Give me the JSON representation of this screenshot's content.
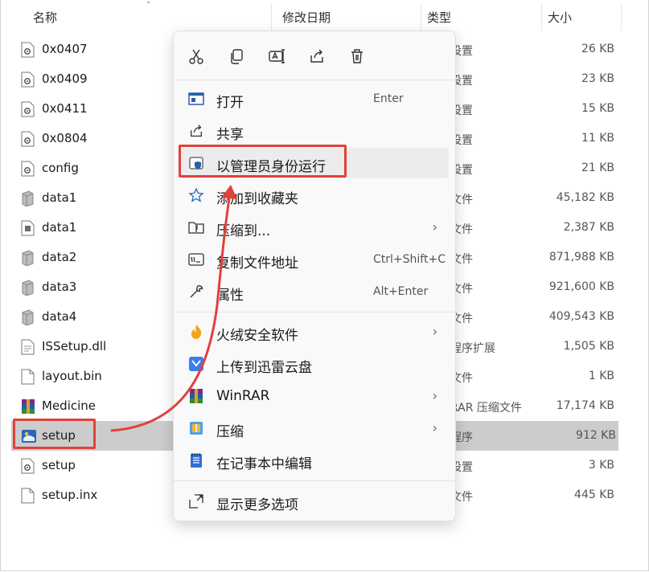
{
  "header": {
    "name": "名称",
    "date": "修改日期",
    "type": "类型",
    "size": "大小"
  },
  "files": [
    {
      "name": "0x0407",
      "icon": "settings-file-icon",
      "type": "设置",
      "size": "26 KB"
    },
    {
      "name": "0x0409",
      "icon": "settings-file-icon",
      "type": "设置",
      "size": "23 KB"
    },
    {
      "name": "0x0411",
      "icon": "settings-file-icon",
      "type": "设置",
      "size": "15 KB"
    },
    {
      "name": "0x0804",
      "icon": "settings-file-icon",
      "type": "设置",
      "size": "11 KB"
    },
    {
      "name": "config",
      "icon": "settings-file-icon",
      "type": "设置",
      "size": "21 KB"
    },
    {
      "name": "data1",
      "icon": "cabinet-file-icon",
      "type": "文件",
      "size": "45,182 KB"
    },
    {
      "name": "data1",
      "icon": "header-file-icon",
      "type": "文件",
      "size": "2,387 KB"
    },
    {
      "name": "data2",
      "icon": "cabinet-file-icon",
      "type": "文件",
      "size": "871,988 KB"
    },
    {
      "name": "data3",
      "icon": "cabinet-file-icon",
      "type": "文件",
      "size": "921,600 KB"
    },
    {
      "name": "data4",
      "icon": "cabinet-file-icon",
      "type": "文件",
      "size": "409,543 KB"
    },
    {
      "name": "ISSetup.dll",
      "icon": "dll-file-icon",
      "type": "程序扩展",
      "size": "1,505 KB"
    },
    {
      "name": "layout.bin",
      "icon": "blank-file-icon",
      "type": "文件",
      "size": "1 KB"
    },
    {
      "name": "Medicine",
      "icon": "winrar-archive-icon",
      "type": "RAR 压缩文件",
      "size": "17,174 KB"
    },
    {
      "name": "setup",
      "icon": "setup-app-icon",
      "type": "程序",
      "size": "912 KB",
      "selected": true
    },
    {
      "name": "setup",
      "icon": "settings-file-icon",
      "type": "设置",
      "size": "3 KB"
    },
    {
      "name": "setup.inx",
      "icon": "blank-file-icon",
      "type": "文件",
      "size": "445 KB"
    }
  ],
  "quick_actions": [
    "cut-icon",
    "copy-icon",
    "rename-icon",
    "share-icon",
    "delete-icon"
  ],
  "menu": {
    "open": {
      "label": "打开",
      "accel": "Enter"
    },
    "share": {
      "label": "共享"
    },
    "run_as_admin": {
      "label": "以管理员身份运行"
    },
    "add_favorites": {
      "label": "添加到收藏夹"
    },
    "compress_to": {
      "label": "压缩到..."
    },
    "copy_path": {
      "label": "复制文件地址",
      "accel": "Ctrl+Shift+C"
    },
    "properties": {
      "label": "属性",
      "accel": "Alt+Enter"
    },
    "huorong": {
      "label": "火绒安全软件"
    },
    "xunlei": {
      "label": "上传到迅雷云盘"
    },
    "winrar": {
      "label": "WinRAR"
    },
    "compress": {
      "label": "压缩"
    },
    "notepad": {
      "label": "在记事本中编辑"
    },
    "more": {
      "label": "显示更多选项"
    }
  },
  "colors": {
    "annotation_red": "#e0413a",
    "selection": "#cccccc",
    "menu_bg": "#f9f9f9"
  }
}
